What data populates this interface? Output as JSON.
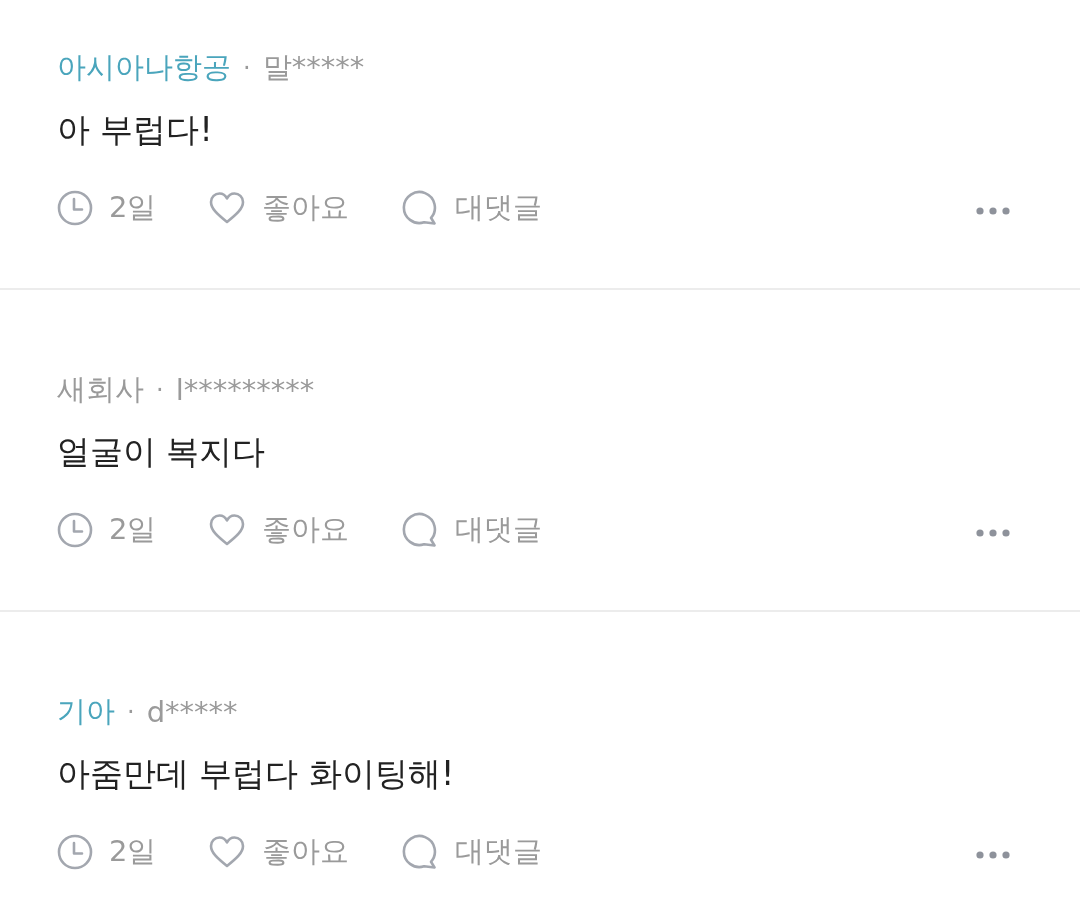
{
  "comments": [
    {
      "company": "아시아나항공",
      "company_verified": true,
      "separator": "·",
      "user": "말*****",
      "text": "아 부럽다!",
      "time": "2일",
      "liked": false,
      "like_label": "좋아요",
      "reply_label": "대댓글"
    },
    {
      "company": "새회사",
      "company_verified": false,
      "separator": "·",
      "user": "l*********",
      "text": "얼굴이 복지다",
      "time": "2일",
      "liked": false,
      "like_label": "좋아요",
      "reply_label": "대댓글"
    },
    {
      "company": "기아",
      "company_verified": true,
      "separator": "·",
      "user": "d*****",
      "text": "아줌만데 부럽다 화이팅해!",
      "time": "2일",
      "liked": false,
      "like_label": "좋아요",
      "reply_label": "대댓글"
    }
  ]
}
